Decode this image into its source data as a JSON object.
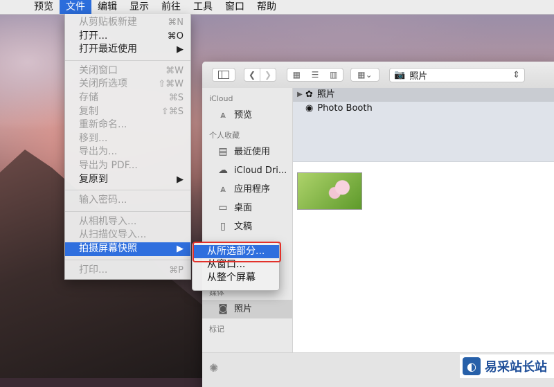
{
  "menubar": {
    "items": [
      "预览",
      "文件",
      "编辑",
      "显示",
      "前往",
      "工具",
      "窗口",
      "帮助"
    ]
  },
  "file_menu": {
    "groups": [
      [
        {
          "label": "从剪贴板新建",
          "shortcut": "⌘N",
          "disabled": true
        },
        {
          "label": "打开...",
          "shortcut": "⌘O",
          "disabled": false
        },
        {
          "label": "打开最近使用",
          "shortcut": "▶",
          "disabled": false
        }
      ],
      [
        {
          "label": "关闭窗口",
          "shortcut": "⌘W",
          "disabled": true
        },
        {
          "label": "关闭所选项",
          "shortcut": "⇧⌘W",
          "disabled": true
        },
        {
          "label": "存储",
          "shortcut": "⌘S",
          "disabled": true
        },
        {
          "label": "复制",
          "shortcut": "⇧⌘S",
          "disabled": true
        },
        {
          "label": "重新命名...",
          "shortcut": "",
          "disabled": true
        },
        {
          "label": "移到...",
          "shortcut": "",
          "disabled": true
        },
        {
          "label": "导出为...",
          "shortcut": "",
          "disabled": true
        },
        {
          "label": "导出为 PDF...",
          "shortcut": "",
          "disabled": true
        },
        {
          "label": "复原到",
          "shortcut": "▶",
          "disabled": false
        }
      ],
      [
        {
          "label": "输入密码...",
          "shortcut": "",
          "disabled": true
        }
      ],
      [
        {
          "label": "从相机导入...",
          "shortcut": "",
          "disabled": true
        },
        {
          "label": "从扫描仪导入...",
          "shortcut": "",
          "disabled": true
        },
        {
          "label": "拍摄屏幕快照",
          "shortcut": "▶",
          "disabled": false,
          "highlight": true
        }
      ],
      [
        {
          "label": "打印...",
          "shortcut": "⌘P",
          "disabled": true
        }
      ]
    ]
  },
  "submenu": {
    "items": [
      "从所选部分...",
      "从窗口...",
      "从整个屏幕"
    ]
  },
  "finder": {
    "path_label": "照片",
    "sidebar": {
      "icloud_header": "iCloud",
      "icloud_items": [
        {
          "label": "预览",
          "icon": "app-icon"
        }
      ],
      "favorites_header": "个人收藏",
      "favorites": [
        {
          "label": "最近使用",
          "icon": "recent-icon"
        },
        {
          "label": "iCloud Dri...",
          "icon": "cloud-icon"
        },
        {
          "label": "应用程序",
          "icon": "app-icon"
        },
        {
          "label": "桌面",
          "icon": "desktop-icon"
        },
        {
          "label": "文稿",
          "icon": "document-icon"
        }
      ],
      "media_header": "媒体",
      "media_items": [
        {
          "label": "照片",
          "icon": "camera-icon"
        }
      ],
      "tags_header": "标记"
    },
    "column": {
      "rows": [
        {
          "label": "照片",
          "icon": "photos-icon"
        },
        {
          "label": "Photo Booth",
          "icon": "photobooth-icon"
        }
      ]
    }
  },
  "watermark": {
    "text": "易采站长站"
  }
}
